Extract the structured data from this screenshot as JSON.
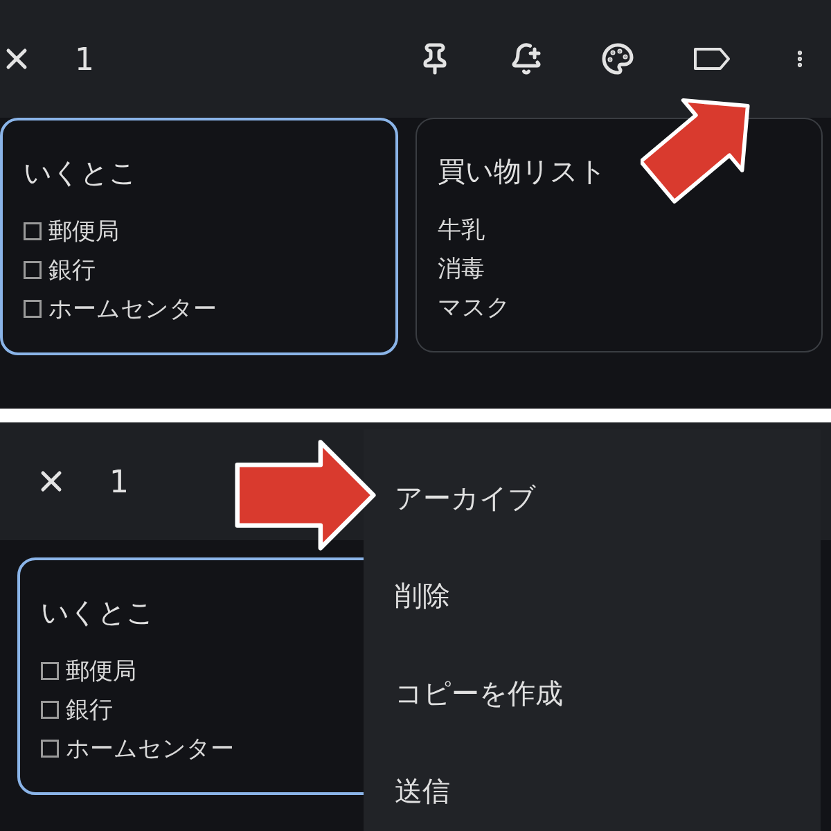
{
  "screens": [
    {
      "toolbar": {
        "count": "1"
      },
      "arrow": {
        "kind": "diagonal"
      },
      "notes": [
        {
          "title": "いくとこ",
          "selected": true,
          "kind": "checklist",
          "items": [
            {
              "text": "郵便局",
              "checked": false
            },
            {
              "text": "銀行",
              "checked": false
            },
            {
              "text": "ホームセンター",
              "checked": false
            }
          ]
        },
        {
          "title": "買い物リスト",
          "selected": false,
          "kind": "text",
          "lines": [
            "牛乳",
            "消毒",
            "マスク"
          ]
        }
      ]
    },
    {
      "toolbar": {
        "count": "1"
      },
      "arrow": {
        "kind": "straight"
      },
      "notes": [
        {
          "title": "いくとこ",
          "selected": true,
          "kind": "checklist",
          "items": [
            {
              "text": "郵便局",
              "checked": false
            },
            {
              "text": "銀行",
              "checked": false
            },
            {
              "text": "ホームセンター",
              "checked": false
            }
          ]
        }
      ],
      "menu": {
        "items": [
          "アーカイブ",
          "削除",
          "コピーを作成",
          "送信"
        ]
      }
    }
  ]
}
